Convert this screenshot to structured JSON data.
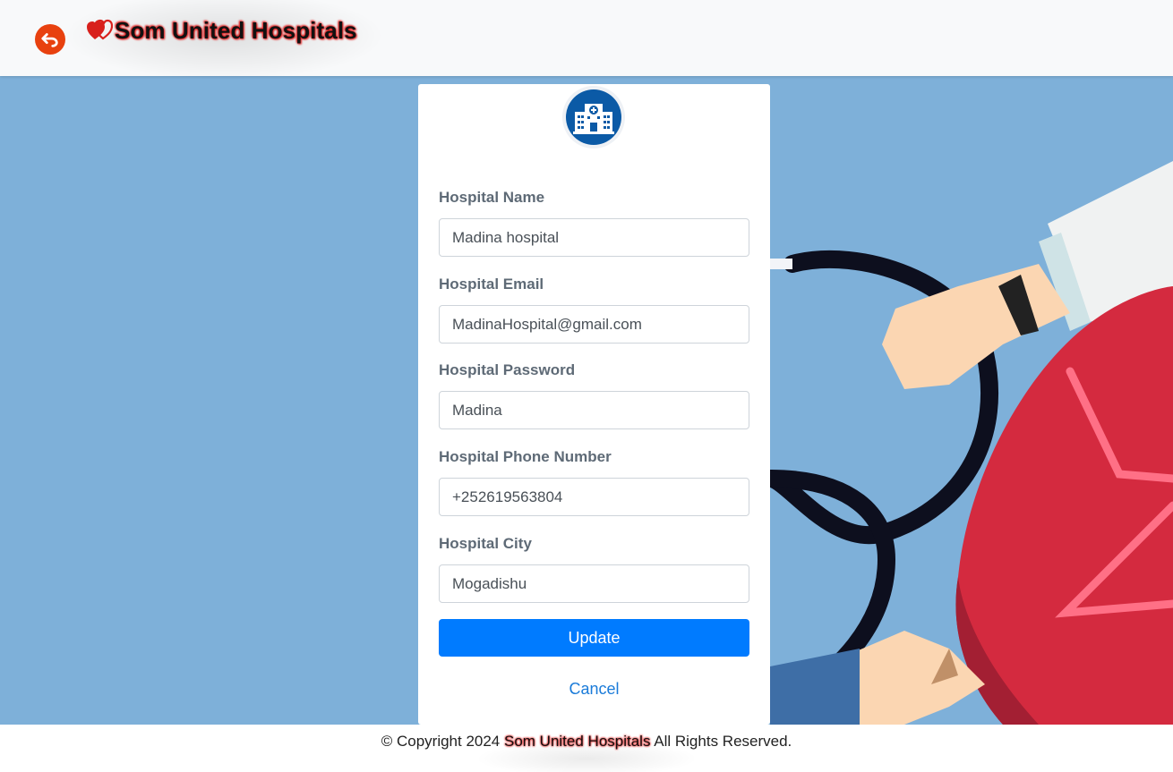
{
  "header": {
    "brand_name": "Som United Hospitals"
  },
  "form": {
    "fields": [
      {
        "label": "Hospital Name",
        "value": "Madina hospital"
      },
      {
        "label": "Hospital Email",
        "value": "MadinaHospital@gmail.com"
      },
      {
        "label": "Hospital Password",
        "value": "Madina"
      },
      {
        "label": "Hospital Phone Number",
        "value": "+252619563804"
      },
      {
        "label": "Hospital City",
        "value": "Mogadishu"
      }
    ],
    "update_label": "Update",
    "cancel_label": "Cancel"
  },
  "footer": {
    "copyright_prefix": "© Copyright 2024",
    "brand_name": "Som United Hospitals",
    "suffix": "All Rights Reserved."
  },
  "icons": {
    "back": "back-arrow-icon",
    "brand": "hearts-logo-icon",
    "hospital": "hospital-building-icon"
  },
  "colors": {
    "primary": "#007bff",
    "brand_glow": "#e01919",
    "back_button": "#e8410f",
    "background": "#7eb0d9",
    "hospital_icon": "#0b5aa6"
  }
}
